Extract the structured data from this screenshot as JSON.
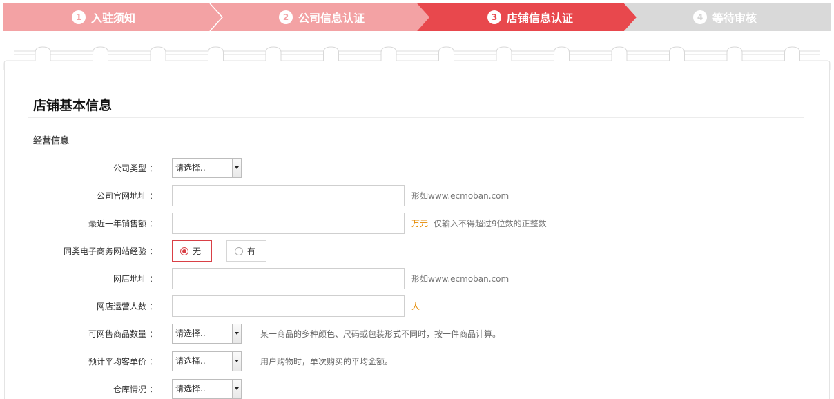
{
  "steps": [
    {
      "num": "1",
      "label": "入驻须知",
      "state": "done"
    },
    {
      "num": "2",
      "label": "公司信息认证",
      "state": "done"
    },
    {
      "num": "3",
      "label": "店铺信息认证",
      "state": "current"
    },
    {
      "num": "4",
      "label": "等待审核",
      "state": "pending"
    }
  ],
  "colors": {
    "done": "#f3a2a4",
    "current": "#e8484d",
    "pending": "#d9d9d9",
    "accent": "#d94046",
    "unit": "#e58a00"
  },
  "section": {
    "title": "店铺基本信息",
    "subtitle": "经营信息"
  },
  "form": {
    "company_type": {
      "label": "公司类型",
      "value": "请选择.."
    },
    "website": {
      "label": "公司官网地址",
      "value": "",
      "hint": "形如www.ecmoban.com"
    },
    "annual_sales": {
      "label": "最近一年销售额",
      "value": "",
      "unit": "万元",
      "hint": "仅输入不得超过9位数的正整数"
    },
    "ecom_experience": {
      "label": "同类电子商务网站经验",
      "options": [
        "无",
        "有"
      ],
      "selected": "无"
    },
    "shop_url": {
      "label": "网店地址",
      "value": "",
      "hint": "形如www.ecmoban.com"
    },
    "shop_staff": {
      "label": "网店运营人数",
      "value": "",
      "unit": "人"
    },
    "product_count": {
      "label": "可网售商品数量",
      "value": "请选择..",
      "hint": "某一商品的多种颜色、尺码或包装形式不同时，按一件商品计算。"
    },
    "avg_price": {
      "label": "预计平均客单价",
      "value": "请选择..",
      "hint": "用户购物时，单次购买的平均金额。"
    },
    "warehouse": {
      "label": "仓库情况",
      "value": "请选择.."
    }
  },
  "colon": "："
}
